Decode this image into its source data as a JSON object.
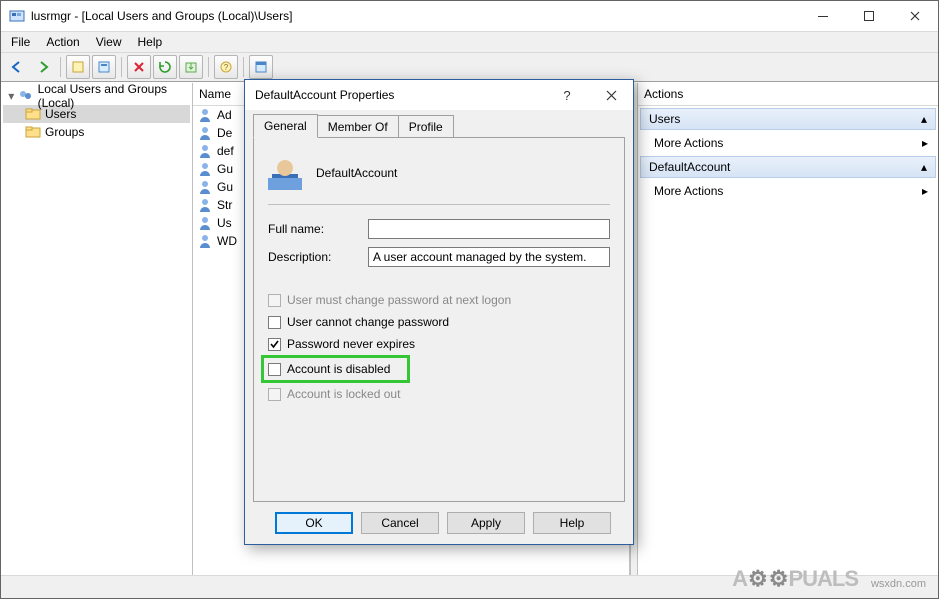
{
  "window": {
    "title": "lusrmgr - [Local Users and Groups (Local)\\Users]"
  },
  "menubar": [
    "File",
    "Action",
    "View",
    "Help"
  ],
  "tree": {
    "root": "Local Users and Groups (Local)",
    "items": [
      "Users",
      "Groups"
    ],
    "selected": "Users"
  },
  "list": {
    "header": "Name",
    "rows": [
      "Ad",
      "De",
      "def",
      "Gu",
      "Gu",
      "Str",
      "Us",
      "WD"
    ]
  },
  "actions": {
    "header": "Actions",
    "group1": "Users",
    "item1": "More Actions",
    "group2": "DefaultAccount",
    "item2": "More Actions"
  },
  "dialog": {
    "title": "DefaultAccount Properties",
    "tabs": [
      "General",
      "Member Of",
      "Profile"
    ],
    "account_name": "DefaultAccount",
    "full_name_label": "Full name:",
    "full_name_value": "",
    "description_label": "Description:",
    "description_value": "A user account managed by the system.",
    "opts": {
      "must_change": "User must change password at next logon",
      "cannot_change": "User cannot change password",
      "never_expires": "Password never expires",
      "disabled": "Account is disabled",
      "locked": "Account is locked out"
    },
    "buttons": {
      "ok": "OK",
      "cancel": "Cancel",
      "apply": "Apply",
      "help": "Help"
    }
  },
  "watermark": "wsxdn.com",
  "brand": {
    "pre": "A",
    "post": "PUALS"
  }
}
